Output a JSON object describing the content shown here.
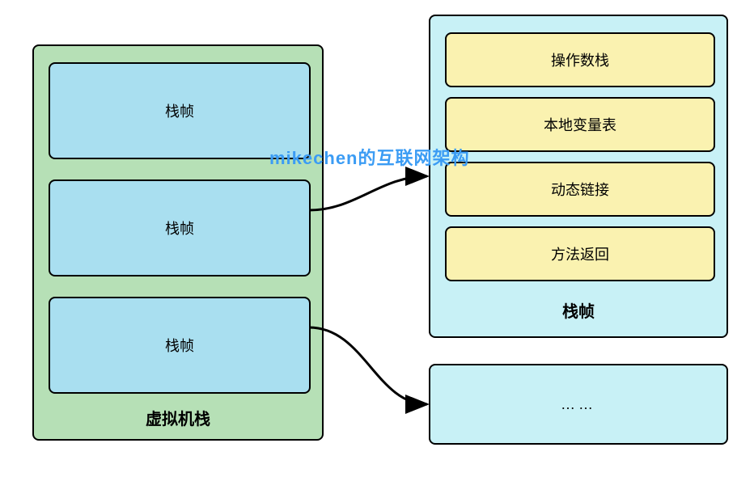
{
  "leftContainer": {
    "title": "虚拟机栈",
    "frames": [
      "栈帧",
      "栈帧",
      "栈帧"
    ]
  },
  "rightContainer": {
    "title": "栈帧",
    "items": [
      "操作数栈",
      "本地变量表",
      "动态链接",
      "方法返回"
    ]
  },
  "ellipsisBox": "……",
  "watermark": "mikechen的互联网架构",
  "colors": {
    "leftContainerFill": "#b6e0b6",
    "frameFill": "#a9dff0",
    "rightContainerFill": "#c8f1f6",
    "rightItemFill": "#faf2b0",
    "ellipsisFill": "#c8f1f6"
  }
}
